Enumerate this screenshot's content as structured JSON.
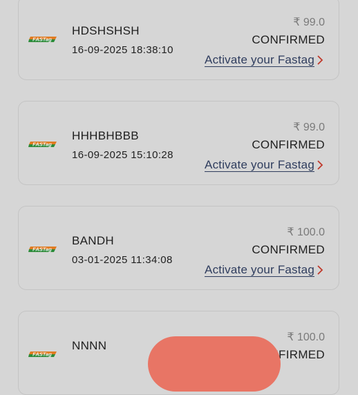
{
  "orders": [
    {
      "name": "HDSHSHSH",
      "datetime": "16-09-2025 18:38:10",
      "amount": "₹ 99.0",
      "status": "CONFIRMED",
      "action_label": "Activate your Fastag"
    },
    {
      "name": "HHHBHBBB",
      "datetime": "16-09-2025 15:10:28",
      "amount": "₹ 99.0",
      "status": "CONFIRMED",
      "action_label": "Activate your Fastag"
    },
    {
      "name": "BANDH",
      "datetime": "03-01-2025 11:34:08",
      "amount": "₹ 100.0",
      "status": "CONFIRMED",
      "action_label": "Activate your Fastag"
    },
    {
      "name": "NNNN",
      "amount": "₹ 100.0",
      "status": "CONFIRMED"
    }
  ],
  "logo": {
    "name": "fastag-logo-icon",
    "text": "FASTag"
  },
  "colors": {
    "background": "#d6d6d6",
    "link": "#2f3d5e",
    "chevron": "#c0392b",
    "fab": "#e87565"
  }
}
